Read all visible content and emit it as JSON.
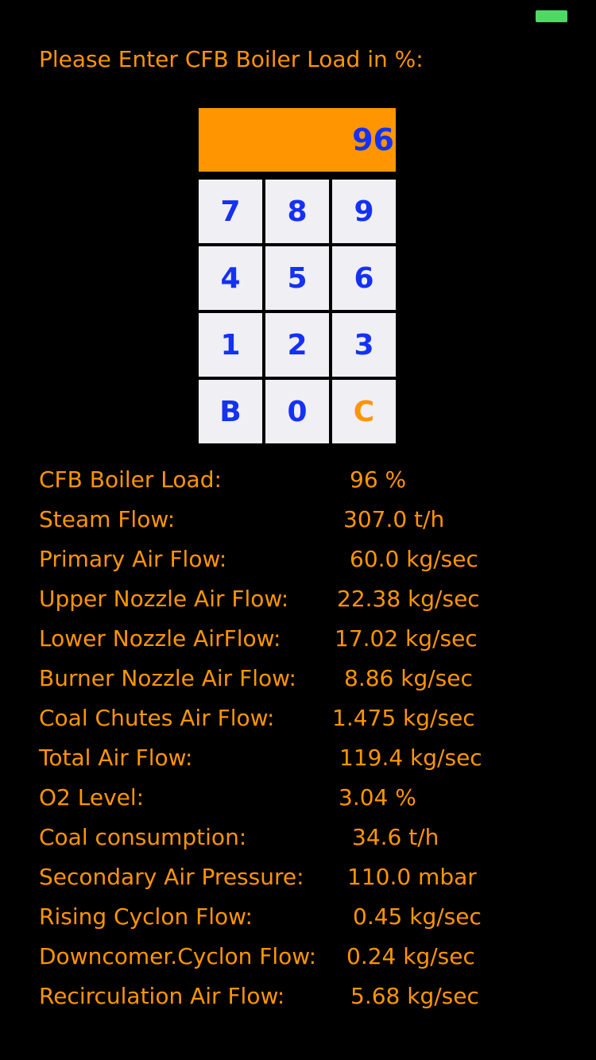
{
  "status_bar": {
    "battery_color": "#4cd964"
  },
  "prompt": "Please Enter CFB Boiler Load in %:",
  "display": {
    "value": "96",
    "background": "#ff9500",
    "text_color": "#1431f5"
  },
  "keypad": {
    "k7": "7",
    "k8": "8",
    "k9": "9",
    "k4": "4",
    "k5": "5",
    "k6": "6",
    "k1": "1",
    "k2": "2",
    "k3": "3",
    "back": "B",
    "k0": "0",
    "clear": "C"
  },
  "results": [
    {
      "label": "CFB Boiler Load:",
      "value": "96 %"
    },
    {
      "label": "Steam Flow:",
      "value": "307.0 t/h"
    },
    {
      "label": "Primary Air Flow:",
      "value": "60.0 kg/sec"
    },
    {
      "label": "Upper Nozzle Air Flow:",
      "value": "22.38 kg/sec"
    },
    {
      "label": "Lower Nozzle AirFlow:",
      "value": "17.02 kg/sec"
    },
    {
      "label": "Burner Nozzle Air Flow:",
      "value": "8.86 kg/sec"
    },
    {
      "label": "Coal Chutes Air Flow:",
      "value": "1.475 kg/sec"
    },
    {
      "label": "Total Air Flow:",
      "value": "119.4 kg/sec"
    },
    {
      "label": "O2 Level:",
      "value": "3.04 %"
    },
    {
      "label": "Coal consumption:",
      "value": "34.6 t/h"
    },
    {
      "label": "Secondary Air Pressure:",
      "value": "110.0 mbar"
    },
    {
      "label": "Rising Cyclon Flow:",
      "value": "0.45 kg/sec"
    },
    {
      "label": "Downcomer.Cyclon Flow:",
      "value": "0.24 kg/sec"
    },
    {
      "label": "Recirculation Air Flow:",
      "value": "5.68 kg/sec"
    }
  ],
  "colors": {
    "accent_orange": "#ff9500",
    "key_blue": "#1431f5",
    "key_background": "#efeff4",
    "background": "#000000"
  }
}
